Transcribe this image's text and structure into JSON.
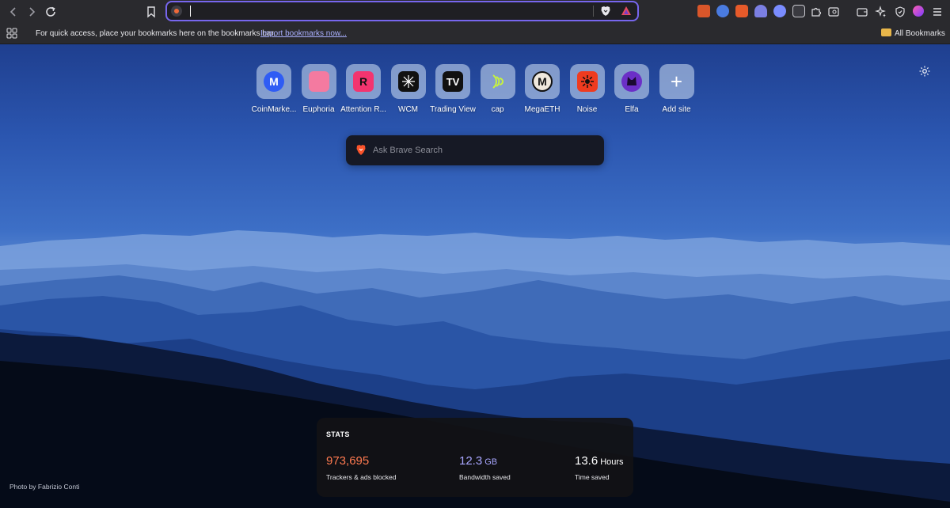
{
  "browser": {
    "address_bar": {
      "value": "",
      "placeholder": ""
    }
  },
  "bookmarks_bar": {
    "hint_text": "For quick access, place your bookmarks here on the bookmarks bar.",
    "import_link": "Import bookmarks now...",
    "all_bookmarks": "All Bookmarks"
  },
  "top_sites": [
    {
      "label": "CoinMarke...",
      "icon": "coinmarketcap-icon",
      "color": "#2f5cf4",
      "glyph": "M"
    },
    {
      "label": "Euphoria",
      "icon": "euphoria-icon",
      "color": "#f47aa0",
      "glyph": ""
    },
    {
      "label": "Attention R...",
      "icon": "attention-icon",
      "color": "#f3346f",
      "glyph": "R"
    },
    {
      "label": "WCM",
      "icon": "wcm-icon",
      "color": "#111111",
      "glyph": ""
    },
    {
      "label": "Trading View",
      "icon": "tradingview-icon",
      "color": "#111111",
      "glyph": "TV"
    },
    {
      "label": "cap",
      "icon": "cap-icon",
      "color": "#c7f43d",
      "glyph": ""
    },
    {
      "label": "MegaETH",
      "icon": "megaeth-icon",
      "color": "#efe8dd",
      "glyph": "M"
    },
    {
      "label": "Noise",
      "icon": "noise-icon",
      "color": "#ef3b1f",
      "glyph": ""
    },
    {
      "label": "Elfa",
      "icon": "elfa-icon",
      "color": "#6b2fc7",
      "glyph": ""
    },
    {
      "label": "Add site",
      "icon": "plus-icon",
      "color": "",
      "glyph": "+"
    }
  ],
  "search": {
    "placeholder": "Ask Brave Search"
  },
  "stats": {
    "title": "STATS",
    "trackers": {
      "value": "973,695",
      "label": "Trackers & ads blocked",
      "color": "#ff7a50"
    },
    "bandwidth": {
      "value": "12.3",
      "unit": "GB",
      "label": "Bandwidth saved",
      "color": "#a8a6ff"
    },
    "time": {
      "value": "13.6",
      "unit": "Hours",
      "label": "Time saved",
      "color": "#ffffff"
    }
  },
  "photo_credit": "Photo by Fabrizio Conti"
}
